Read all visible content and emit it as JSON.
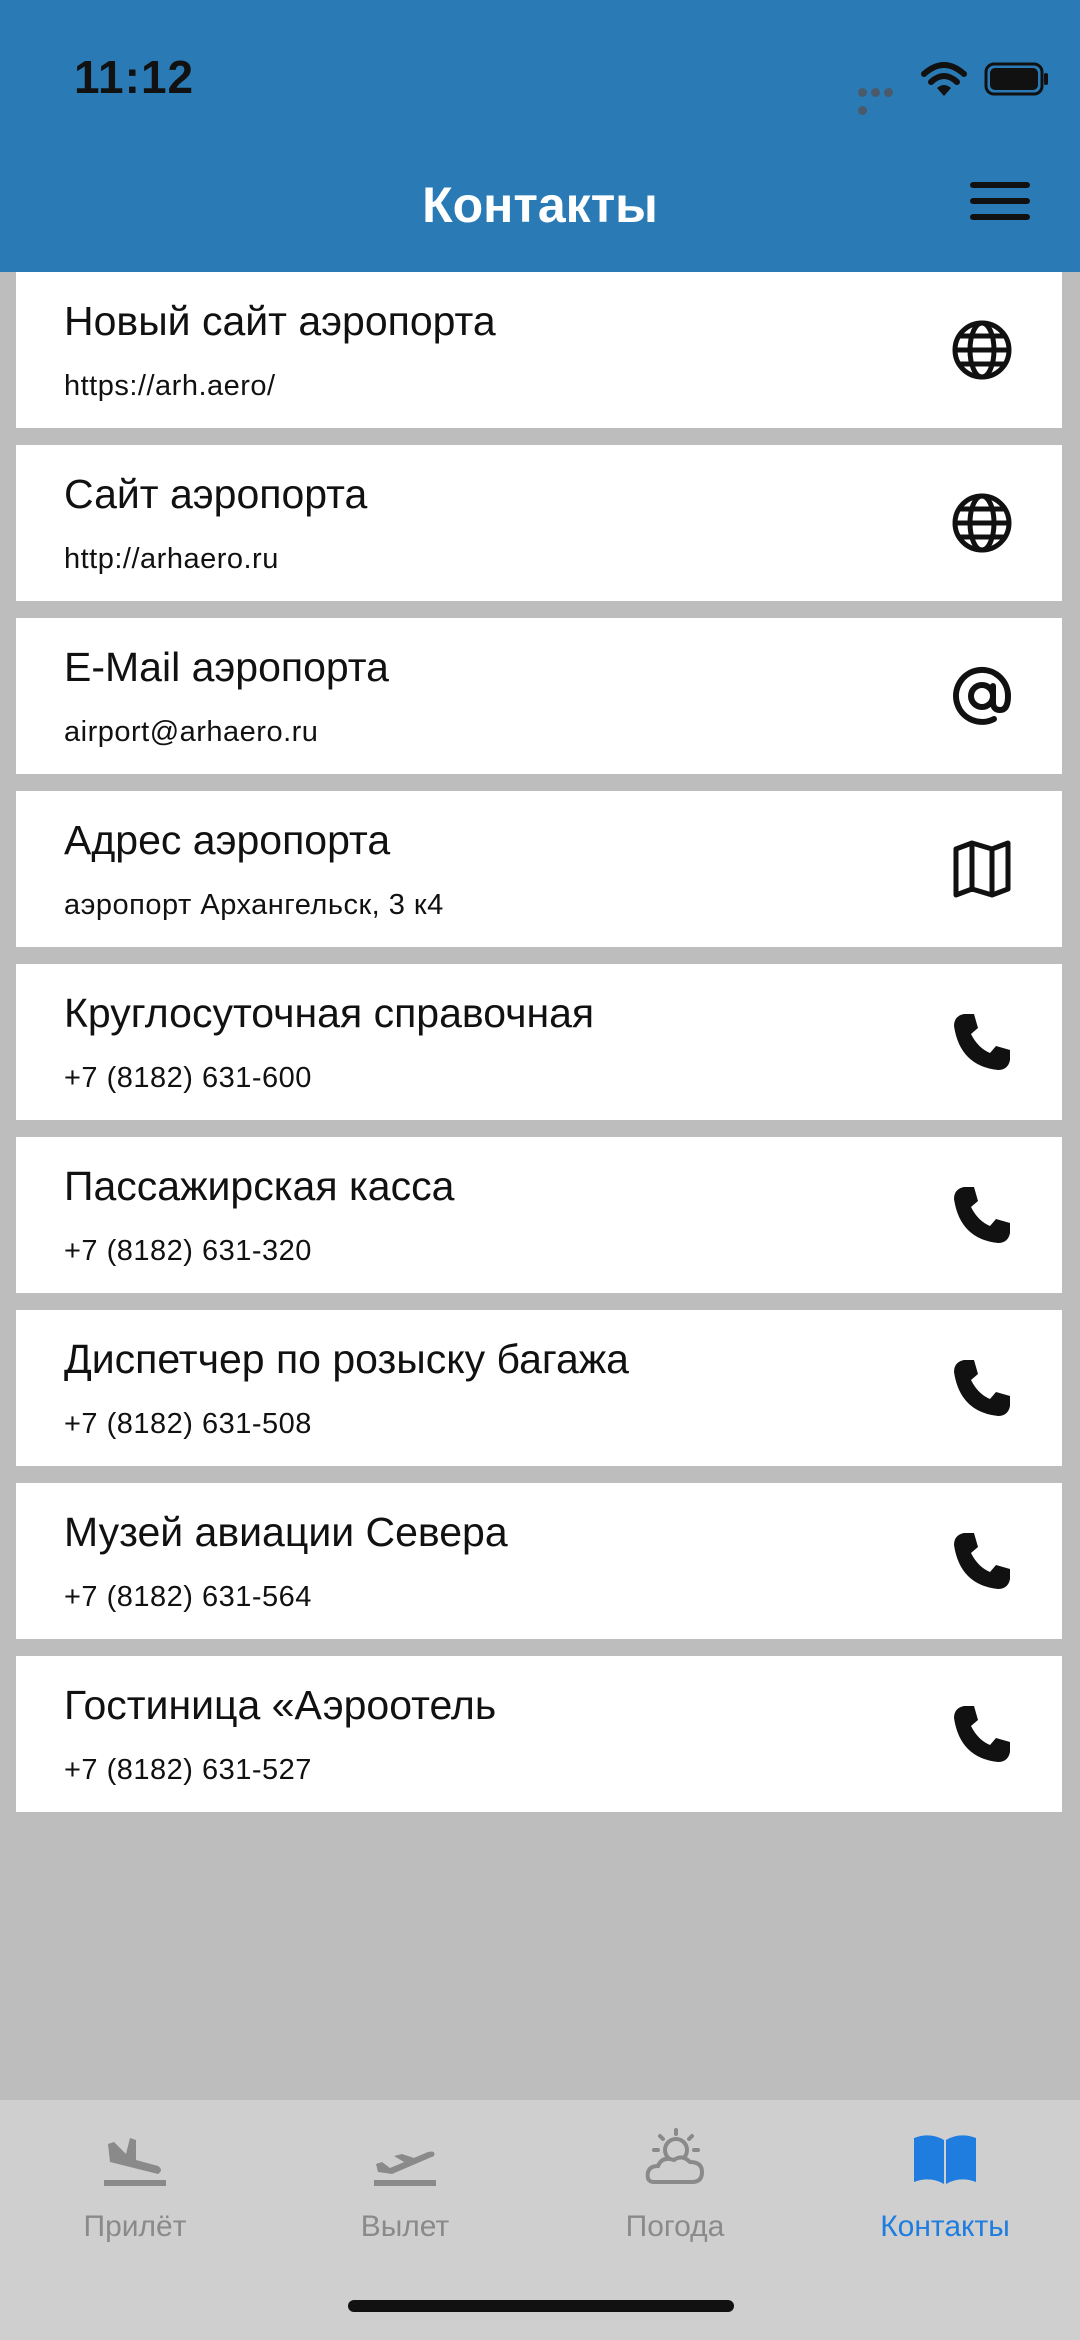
{
  "status": {
    "time": "11:12"
  },
  "header": {
    "title": "Контакты"
  },
  "contacts": [
    {
      "title": "Новый сайт аэропорта",
      "subtitle": "https://arh.aero/",
      "icon": "globe-icon"
    },
    {
      "title": "Сайт аэропорта",
      "subtitle": "http://arhaero.ru",
      "icon": "globe-icon"
    },
    {
      "title": "E-Mail аэропорта",
      "subtitle": "airport@arhaero.ru",
      "icon": "at-icon"
    },
    {
      "title": "Адрес аэропорта",
      "subtitle": "аэропорт Архангельск, 3 к4",
      "icon": "map-icon"
    },
    {
      "title": "Круглосуточная справочная",
      "subtitle": "+7 (8182) 631-600",
      "icon": "phone-icon"
    },
    {
      "title": "Пассажирская касса",
      "subtitle": "+7 (8182) 631-320",
      "icon": "phone-icon"
    },
    {
      "title": "Диспетчер по розыску багажа",
      "subtitle": "+7 (8182) 631-508",
      "icon": "phone-icon"
    },
    {
      "title": "Музей авиации Севера",
      "subtitle": "+7 (8182) 631-564",
      "icon": "phone-icon"
    },
    {
      "title": "Гостиница «Аэроотель",
      "subtitle": "+7 (8182) 631-527",
      "icon": "phone-icon"
    }
  ],
  "tabs": [
    {
      "label": "Прилёт",
      "icon": "plane-arrival-icon",
      "active": false
    },
    {
      "label": "Вылет",
      "icon": "plane-departure-icon",
      "active": false
    },
    {
      "label": "Погода",
      "icon": "weather-icon",
      "active": false
    },
    {
      "label": "Контакты",
      "icon": "book-icon",
      "active": true
    }
  ],
  "colors": {
    "header": "#2a7bb5",
    "background": "#bdbdbd",
    "tabbar": "#cfcfcf",
    "active_tab": "#1e7ddf",
    "inactive_tab": "#8a8a8a"
  }
}
